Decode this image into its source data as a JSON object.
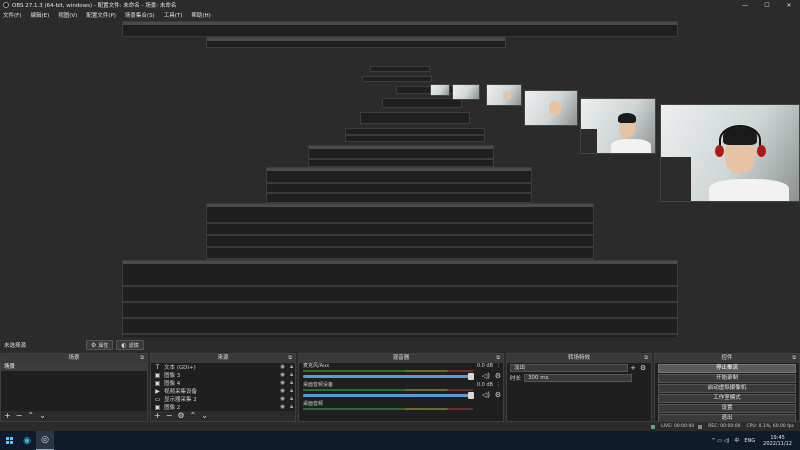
{
  "window": {
    "title": "OBS 27.1.3 (64-bit, windows) - 配置文件: 未命名 - 场景: 未命名",
    "controls": [
      "—",
      "☐",
      "✕"
    ]
  },
  "menu": [
    "文件(F)",
    "编辑(E)",
    "视图(V)",
    "配置文件(P)",
    "场景集合(S)",
    "工具(T)",
    "帮助(H)"
  ],
  "dockbar": {
    "scene_title": "未选择源",
    "properties_label": "属性",
    "filters_label": "滤镜"
  },
  "scenes": {
    "title": "场景",
    "items": [
      "场景"
    ]
  },
  "sources": {
    "title": "来源",
    "items": [
      {
        "label": "文本 (GDI+)",
        "icon": "text-icon"
      },
      {
        "label": "图像 3",
        "icon": "image-icon"
      },
      {
        "label": "图像 4",
        "icon": "image-icon"
      },
      {
        "label": "视频采集设备",
        "icon": "camera-icon"
      },
      {
        "label": "显示器采集 2",
        "icon": "monitor-icon"
      },
      {
        "label": "图像 2",
        "icon": "image-icon"
      }
    ]
  },
  "mixer": {
    "title": "混音器",
    "channels": [
      {
        "name": "麦克风/Aux",
        "db": "0.0 dB"
      },
      {
        "name": "桌面音频设备",
        "db": "0.0 dB"
      },
      {
        "name": "桌面音频",
        "db": ""
      }
    ]
  },
  "transitions": {
    "title": "转场特效",
    "type": "淡出",
    "duration_label": "时长",
    "duration": "300 ms"
  },
  "controls": {
    "title": "控件",
    "buttons": [
      "停止推流",
      "开始录制",
      "启动虚拟摄像机",
      "工作室模式",
      "设置",
      "退出"
    ]
  },
  "status": {
    "live": "LIVE: 00:00:00",
    "rec": "REC: 00:00:00",
    "cpu": "CPU: 0.1%, 60.00 fps"
  },
  "taskbar": {
    "tray_icons": "^ ▭ ◁)",
    "ime": "中",
    "lang": "ENG",
    "time": "19:45",
    "date": "2022/11/12"
  }
}
